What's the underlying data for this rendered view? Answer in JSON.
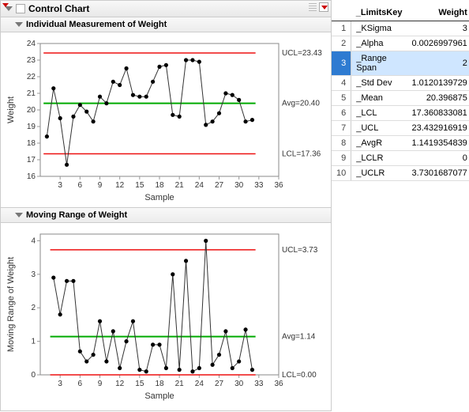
{
  "header": {
    "title": "Control Chart"
  },
  "charts": [
    {
      "title": "Individual Measurement of Weight",
      "xlabel": "Sample",
      "ylabel": "Weight",
      "ucl_label": "UCL=23.43",
      "avg_label": "Avg=20.40",
      "lcl_label": "LCL=17.36"
    },
    {
      "title": "Moving Range of Weight",
      "xlabel": "Sample",
      "ylabel": "Moving Range of Weight",
      "ucl_label": "UCL=3.73",
      "avg_label": "Avg=1.14",
      "lcl_label": "LCL=0.00"
    }
  ],
  "table": {
    "headers": {
      "key": "_LimitsKey",
      "value": "Weight"
    },
    "rows": [
      {
        "i": "1",
        "key": "_KSigma",
        "val": "3"
      },
      {
        "i": "2",
        "key": "_Alpha",
        "val": "0.0026997961"
      },
      {
        "i": "3",
        "key": "_Range Span",
        "val": "2",
        "sel": true
      },
      {
        "i": "4",
        "key": "_Std Dev",
        "val": "1.0120139729"
      },
      {
        "i": "5",
        "key": "_Mean",
        "val": "20.396875"
      },
      {
        "i": "6",
        "key": "_LCL",
        "val": "17.360833081"
      },
      {
        "i": "7",
        "key": "_UCL",
        "val": "23.432916919"
      },
      {
        "i": "8",
        "key": "_AvgR",
        "val": "1.1419354839"
      },
      {
        "i": "9",
        "key": "_LCLR",
        "val": "0"
      },
      {
        "i": "10",
        "key": "_UCLR",
        "val": "3.7301687077"
      }
    ]
  },
  "chart_data": [
    {
      "type": "line",
      "title": "Individual Measurement of Weight",
      "xlabel": "Sample",
      "ylabel": "Weight",
      "xlim": [
        0,
        36
      ],
      "ylim": [
        16,
        24
      ],
      "xticks": [
        3,
        6,
        9,
        12,
        15,
        18,
        21,
        24,
        27,
        30,
        33,
        36
      ],
      "yticks": [
        16,
        17,
        18,
        19,
        20,
        21,
        22,
        23,
        24
      ],
      "limits": {
        "ucl": 23.43,
        "avg": 20.4,
        "lcl": 17.36
      },
      "x": [
        1,
        2,
        3,
        4,
        5,
        6,
        7,
        8,
        9,
        10,
        11,
        12,
        13,
        14,
        15,
        16,
        17,
        18,
        19,
        20,
        21,
        22,
        23,
        24,
        25,
        26,
        27,
        28,
        29,
        30,
        31,
        32
      ],
      "values": [
        18.4,
        21.3,
        19.5,
        16.7,
        19.6,
        20.3,
        19.9,
        19.3,
        20.8,
        20.4,
        21.7,
        21.5,
        22.5,
        20.9,
        20.8,
        20.8,
        21.7,
        22.6,
        22.7,
        19.7,
        19.6,
        23.0,
        23.0,
        22.9,
        19.1,
        19.3,
        19.8,
        21.0,
        20.9,
        20.6,
        19.3,
        19.4
      ]
    },
    {
      "type": "line",
      "title": "Moving Range of Weight",
      "xlabel": "Sample",
      "ylabel": "Moving Range of Weight",
      "xlim": [
        0,
        36
      ],
      "ylim": [
        0,
        4.2
      ],
      "xticks": [
        3,
        6,
        9,
        12,
        15,
        18,
        21,
        24,
        27,
        30,
        33,
        36
      ],
      "yticks": [
        0,
        1,
        2,
        3,
        4
      ],
      "limits": {
        "ucl": 3.73,
        "avg": 1.14,
        "lcl": 0.0
      },
      "x": [
        2,
        3,
        4,
        5,
        6,
        7,
        8,
        9,
        10,
        11,
        12,
        13,
        14,
        15,
        16,
        17,
        18,
        19,
        20,
        21,
        22,
        23,
        24,
        25,
        26,
        27,
        28,
        29,
        30,
        31,
        32
      ],
      "values": [
        2.9,
        1.8,
        2.8,
        2.8,
        0.7,
        0.4,
        0.6,
        1.6,
        0.4,
        1.3,
        0.2,
        1.0,
        1.6,
        0.15,
        0.1,
        0.9,
        0.9,
        0.2,
        3.0,
        0.15,
        3.4,
        0.1,
        0.2,
        4.0,
        0.3,
        0.6,
        1.3,
        0.2,
        0.4,
        1.35,
        0.15
      ]
    }
  ]
}
